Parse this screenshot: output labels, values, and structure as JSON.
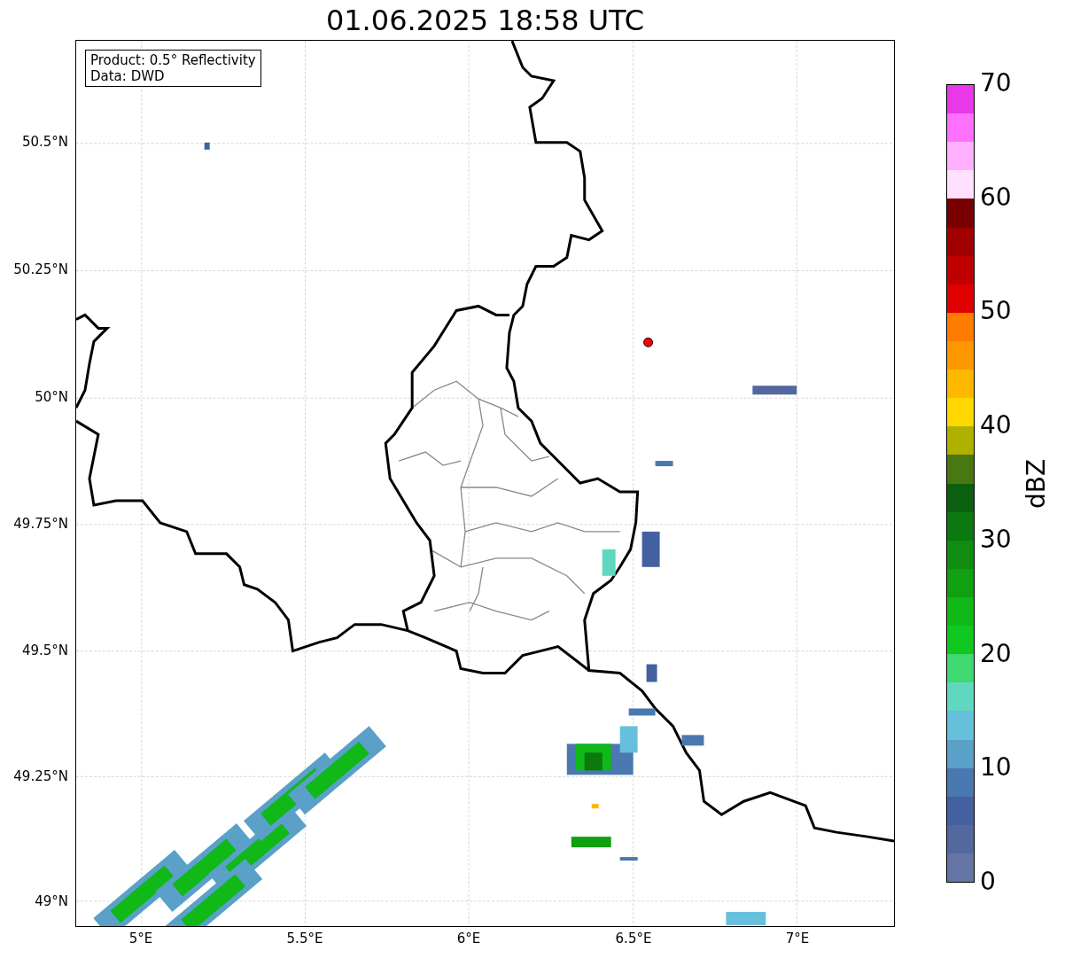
{
  "title": "01.06.2025 18:58 UTC",
  "info_box": [
    "Product: 0.5° Reflectivity",
    "Data: DWD"
  ],
  "y_ticks": [
    "50.5°N",
    "50.25°N",
    "50°N",
    "49.75°N",
    "49.5°N",
    "49.25°N",
    "49°N"
  ],
  "x_ticks": [
    "5°E",
    "5.5°E",
    "6°E",
    "6.5°E",
    "7°E"
  ],
  "colorbar": {
    "label": "dBZ",
    "ticks": [
      "70",
      "60",
      "50",
      "40",
      "30",
      "20",
      "10",
      "0"
    ],
    "segments": [
      {
        "color": "#e838e8"
      },
      {
        "color": "#ff70ff"
      },
      {
        "color": "#ffb0ff"
      },
      {
        "color": "#ffe0ff"
      },
      {
        "color": "#780000"
      },
      {
        "color": "#a00000"
      },
      {
        "color": "#c00000"
      },
      {
        "color": "#e00000"
      },
      {
        "color": "#ff7c00"
      },
      {
        "color": "#ff9800"
      },
      {
        "color": "#ffb800"
      },
      {
        "color": "#ffd800"
      },
      {
        "color": "#b0b000"
      },
      {
        "color": "#487810"
      },
      {
        "color": "#0a6010"
      },
      {
        "color": "#0c7810"
      },
      {
        "color": "#108c10"
      },
      {
        "color": "#10a010"
      },
      {
        "color": "#10b818"
      },
      {
        "color": "#10c820"
      },
      {
        "color": "#40d870"
      },
      {
        "color": "#60d8c0"
      },
      {
        "color": "#66c0dc"
      },
      {
        "color": "#5aa0c8"
      },
      {
        "color": "#4a78b0"
      },
      {
        "color": "#4460a0"
      },
      {
        "color": "#5468a0"
      },
      {
        "color": "#6474a4"
      }
    ]
  }
}
